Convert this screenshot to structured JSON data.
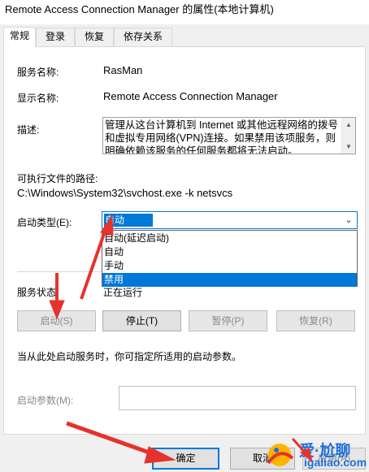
{
  "window": {
    "title": "Remote Access Connection Manager 的属性(本地计算机)"
  },
  "tabs": [
    {
      "label": "常规"
    },
    {
      "label": "登录"
    },
    {
      "label": "恢复"
    },
    {
      "label": "依存关系"
    }
  ],
  "general": {
    "service_name_label": "服务名称:",
    "service_name_value": "RasMan",
    "display_name_label": "显示名称:",
    "display_name_value": "Remote Access Connection Manager",
    "description_label": "描述:",
    "description_value": "管理从这台计算机到 Internet 或其他远程网络的拨号和虚拟专用网络(VPN)连接。如果禁用该项服务，则明确依赖该服务的任何服务都将无法启动。",
    "exe_path_label": "可执行文件的路径:",
    "exe_path_value": "C:\\Windows\\System32\\svchost.exe -k netsvcs",
    "startup_type_label": "启动类型(E):",
    "startup_type_selected": "自动",
    "startup_type_options": [
      "自动(延迟启动)",
      "自动",
      "手动",
      "禁用"
    ],
    "startup_type_highlighted": "禁用",
    "service_status_label": "服务状态:",
    "service_status_value": "正在运行",
    "start_button": "启动(S)",
    "stop_button": "停止(T)",
    "pause_button": "暂停(P)",
    "resume_button": "恢复(R)",
    "hint_text": "当从此处启动服务时，你可指定所适用的启动参数。",
    "start_params_label": "启动参数(M):",
    "start_params_value": ""
  },
  "footer": {
    "ok_button": "确定",
    "cancel_button": "取消",
    "apply_button": "应用(A)"
  },
  "watermark": {
    "line1": "爱·尬聊",
    "line2": "igaliao.com"
  },
  "colors": {
    "accent": "#0078d7",
    "annotation_arrow": "#e5322d",
    "watermark": "#1e6fd9"
  }
}
